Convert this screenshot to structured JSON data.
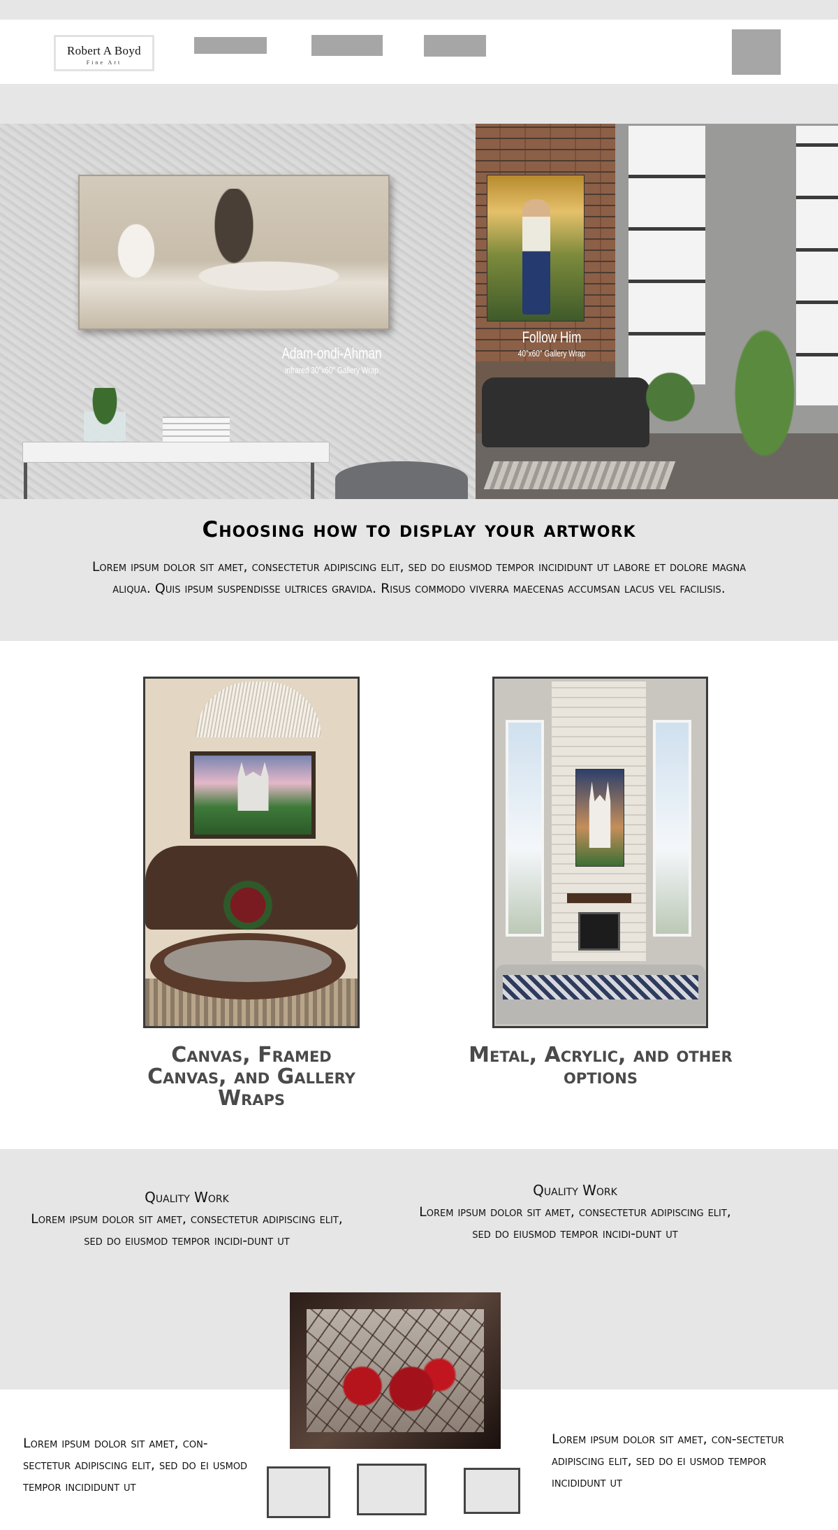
{
  "header": {
    "logo_name": "Robert A Boyd",
    "logo_sub": "Fine Art"
  },
  "hero": {
    "art1_title": "Adam-ondi-Ahman",
    "art1_sub": "infrared 30\"x60\" Gallery Wrap",
    "art2_title": "Follow Him",
    "art2_sub": "40\"x60\" Gallery Wrap"
  },
  "intro": {
    "heading": "Choosing how to display your artwork",
    "body": "Lorem ipsum dolor sit amet, consectetur adipiscing elit, sed do eiusmod tempor incididunt ut labore et dolore magna aliqua. Quis ipsum suspendisse ultrices gravida. Risus commodo viverra maecenas accumsan lacus vel facilisis."
  },
  "cards": [
    {
      "title": "Canvas, Framed Canvas, and Gallery Wraps"
    },
    {
      "title": "Metal, Acrylic, and other options"
    }
  ],
  "quality": [
    {
      "title": "Quality Work",
      "body": "Lorem ipsum dolor sit amet, consectetur adipiscing elit, sed do eiusmod tempor incidi-dunt ut"
    },
    {
      "title": "Quality Work",
      "body": "Lorem ipsum dolor sit amet, consectetur adipiscing elit, sed do eiusmod tempor incidi-dunt ut"
    }
  ],
  "lower": {
    "left": "Lorem ipsum dolor sit amet, con-sectetur adipiscing elit, sed do ei usmod tempor incididunt ut",
    "right": "Lorem ipsum dolor sit amet, con-sectetur adipiscing elit, sed do ei usmod tempor incididunt ut"
  }
}
